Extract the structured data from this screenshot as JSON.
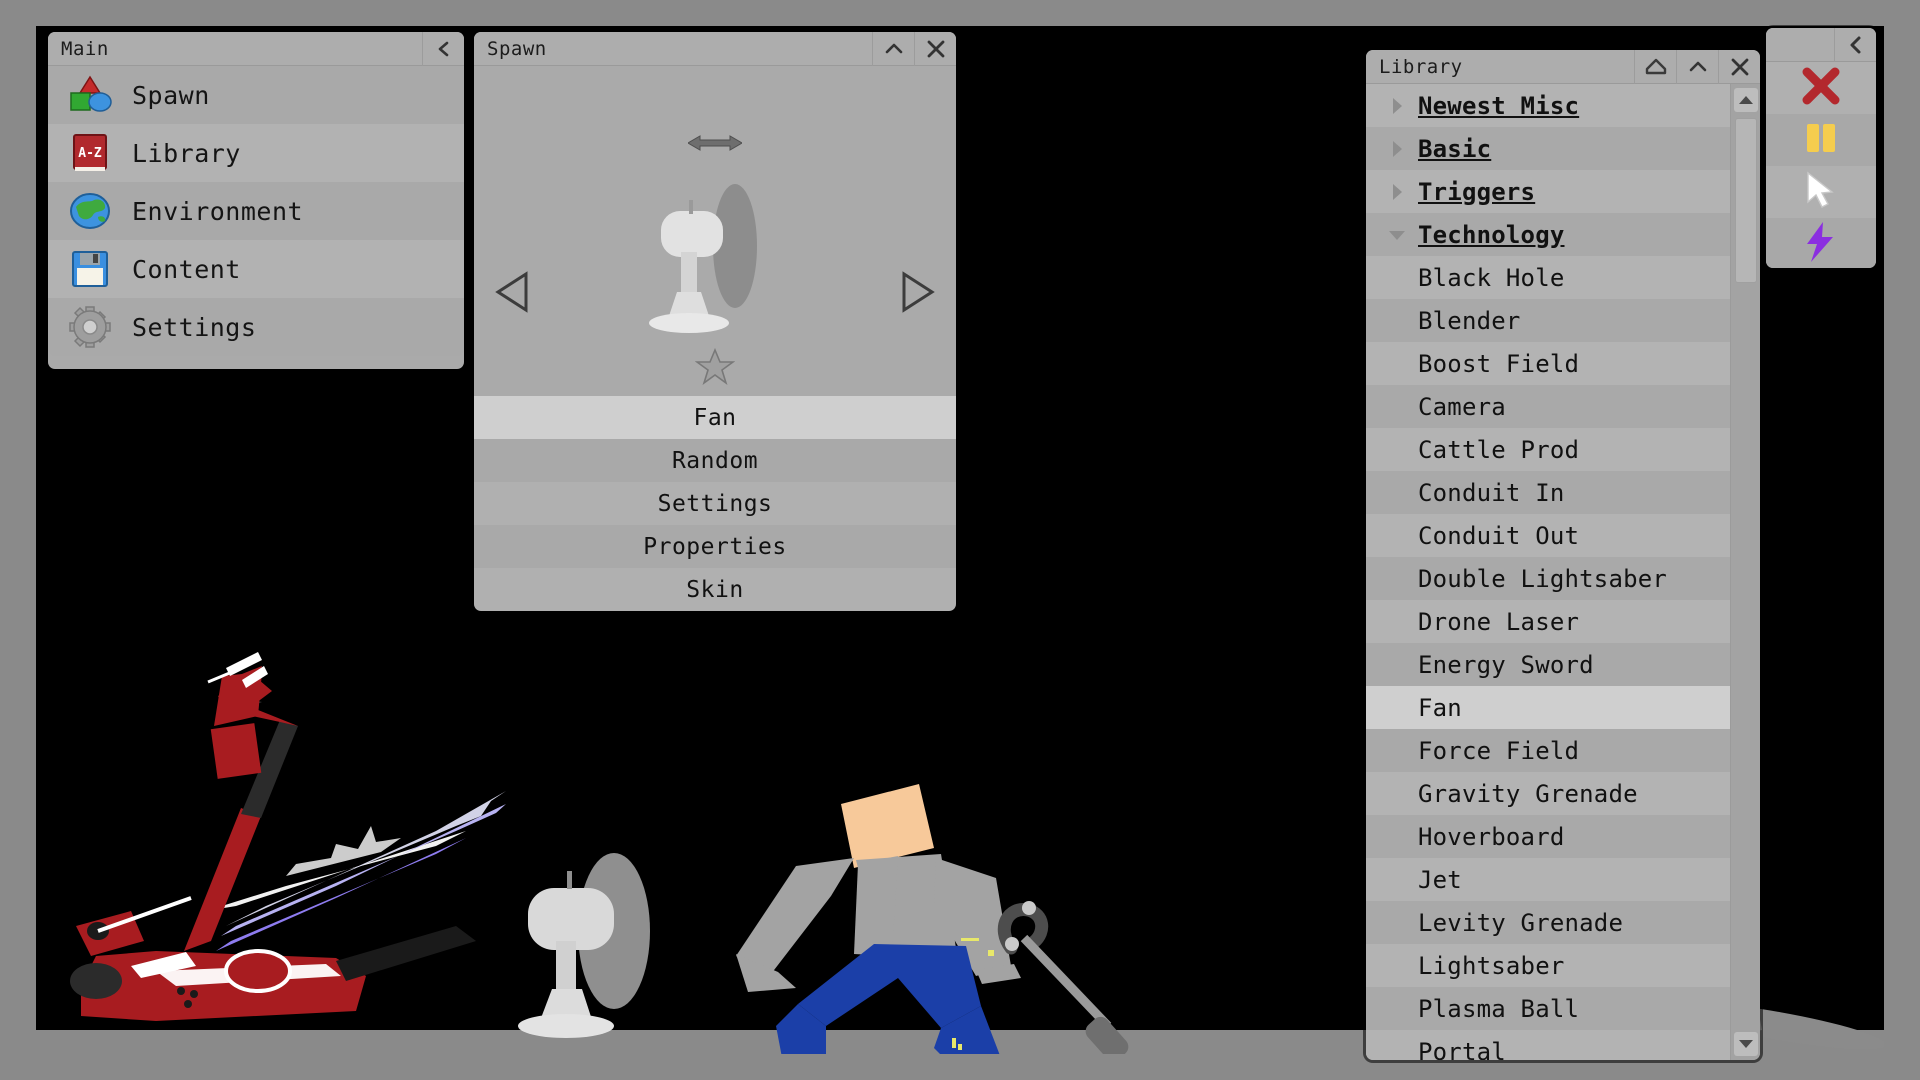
{
  "app": {
    "viewport_bg": "#000000",
    "frame_bg": "#8a8a8a",
    "panel_bg": "#aaaaaa",
    "accent_selected": "#cfcfcf"
  },
  "main_panel": {
    "title": "Main",
    "collapse_label": "<",
    "items": [
      {
        "label": "Spawn",
        "icon": "shapes-icon"
      },
      {
        "label": "Library",
        "icon": "book-a-z-icon"
      },
      {
        "label": "Environment",
        "icon": "globe-icon"
      },
      {
        "label": "Content",
        "icon": "floppy-disk-icon"
      },
      {
        "label": "Settings",
        "icon": "gear-icon"
      }
    ]
  },
  "spawn_panel": {
    "title": "Spawn",
    "collapse_label": "^",
    "close_label": "X",
    "pan_icon": "left-right-arrow-icon",
    "prev_icon": "triangle-left-icon",
    "next_icon": "triangle-right-icon",
    "favorite_icon": "star-icon",
    "preview_object": "Fan",
    "buttons": [
      {
        "label": "Fan",
        "state": "selected"
      },
      {
        "label": "Random",
        "state": "normal"
      },
      {
        "label": "Settings",
        "state": "normal"
      },
      {
        "label": "Properties",
        "state": "normal"
      },
      {
        "label": "Skin",
        "state": "normal"
      }
    ]
  },
  "library_panel": {
    "title": "Library",
    "home_label": "home-icon",
    "collapse_label": "^",
    "close_label": "X",
    "scrollbar": {
      "up_icon": "caret-up-icon",
      "down_icon": "caret-down-icon",
      "thumb_position_pct": 4
    },
    "rows": [
      {
        "label": "Newest Misc",
        "type": "category",
        "expanded": false,
        "selected": false
      },
      {
        "label": "Basic",
        "type": "category",
        "expanded": false,
        "selected": false
      },
      {
        "label": "Triggers",
        "type": "category",
        "expanded": false,
        "selected": false
      },
      {
        "label": "Technology",
        "type": "category",
        "expanded": true,
        "selected": false
      },
      {
        "label": "Black Hole",
        "type": "item",
        "selected": false
      },
      {
        "label": "Blender",
        "type": "item",
        "selected": false
      },
      {
        "label": "Boost Field",
        "type": "item",
        "selected": false
      },
      {
        "label": "Camera",
        "type": "item",
        "selected": false
      },
      {
        "label": "Cattle Prod",
        "type": "item",
        "selected": false
      },
      {
        "label": "Conduit In",
        "type": "item",
        "selected": false
      },
      {
        "label": "Conduit Out",
        "type": "item",
        "selected": false
      },
      {
        "label": "Double Lightsaber",
        "type": "item",
        "selected": false
      },
      {
        "label": "Drone Laser",
        "type": "item",
        "selected": false
      },
      {
        "label": "Energy Sword",
        "type": "item",
        "selected": false
      },
      {
        "label": "Fan",
        "type": "item",
        "selected": true
      },
      {
        "label": "Force Field",
        "type": "item",
        "selected": false
      },
      {
        "label": "Gravity Grenade",
        "type": "item",
        "selected": false
      },
      {
        "label": "Hoverboard",
        "type": "item",
        "selected": false
      },
      {
        "label": "Jet",
        "type": "item",
        "selected": false
      },
      {
        "label": "Levity Grenade",
        "type": "item",
        "selected": false
      },
      {
        "label": "Lightsaber",
        "type": "item",
        "selected": false
      },
      {
        "label": "Plasma Ball",
        "type": "item",
        "selected": false
      },
      {
        "label": "Portal",
        "type": "item",
        "selected": false
      }
    ]
  },
  "tool_panel": {
    "collapse_label": "<",
    "tools": [
      {
        "name": "delete-tool",
        "icon": "red-x-icon",
        "color": "#b3282d"
      },
      {
        "name": "pause-tool",
        "icon": "yellow-pause-icon",
        "color": "#f5cd4e"
      },
      {
        "name": "select-tool",
        "icon": "white-cursor-icon",
        "color": "#ffffff"
      },
      {
        "name": "lightning-tool",
        "icon": "purple-lightning-icon",
        "color": "#8b2fe0"
      }
    ]
  },
  "scene": {
    "objects": [
      {
        "name": "red-scooter",
        "color": "#a81c20"
      },
      {
        "name": "energy-blade",
        "color": "#8e7cf0"
      },
      {
        "name": "fan",
        "color": "#d8d8d8"
      },
      {
        "name": "ragdoll-character",
        "skin": "#f7c99a",
        "shirt": "#a3a3a3",
        "pants": "#1b3fa8"
      },
      {
        "name": "cattle-prod",
        "color": "#555555"
      }
    ]
  }
}
